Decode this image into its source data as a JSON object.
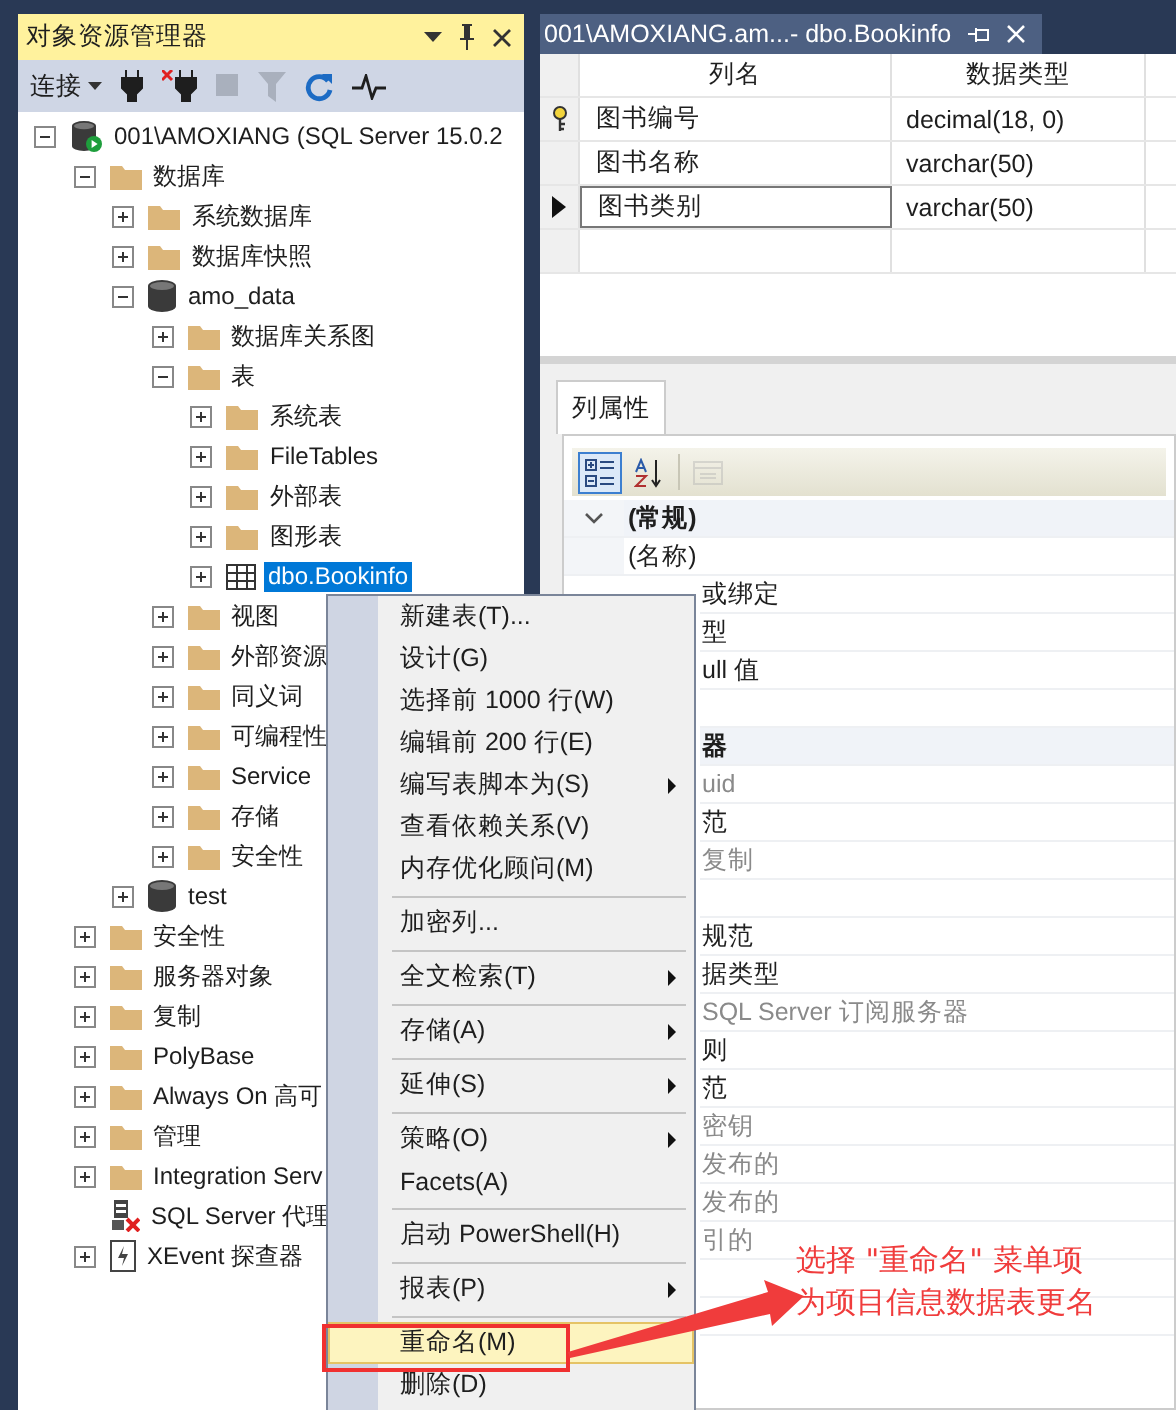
{
  "object_explorer": {
    "title": "对象资源管理器",
    "toolbar": {
      "connect_label": "连接",
      "buttons": [
        {
          "kind": "connect",
          "disabled": false
        },
        {
          "kind": "disconnect",
          "disabled": false
        },
        {
          "kind": "stop",
          "disabled": true
        },
        {
          "kind": "filter",
          "disabled": true
        },
        {
          "kind": "refresh",
          "disabled": false
        },
        {
          "kind": "activity",
          "disabled": false
        }
      ]
    },
    "tree": [
      {
        "label": "001\\AMOXIANG (SQL Server 15.0.2",
        "kind": "server",
        "expanded": true,
        "selected": false,
        "children": [
          {
            "label": "数据库",
            "kind": "folder",
            "expanded": true,
            "selected": false,
            "children": [
              {
                "label": "系统数据库",
                "kind": "folder",
                "expanded": false,
                "selected": false
              },
              {
                "label": "数据库快照",
                "kind": "folder",
                "expanded": false,
                "selected": false
              },
              {
                "label": "amo_data",
                "kind": "database",
                "expanded": true,
                "selected": false,
                "children": [
                  {
                    "label": "数据库关系图",
                    "kind": "folder",
                    "expanded": false,
                    "selected": false
                  },
                  {
                    "label": "表",
                    "kind": "folder",
                    "expanded": true,
                    "selected": false,
                    "children": [
                      {
                        "label": "系统表",
                        "kind": "folder",
                        "expanded": false,
                        "selected": false
                      },
                      {
                        "label": "FileTables",
                        "kind": "folder",
                        "expanded": false,
                        "selected": false
                      },
                      {
                        "label": "外部表",
                        "kind": "folder",
                        "expanded": false,
                        "selected": false
                      },
                      {
                        "label": "图形表",
                        "kind": "folder",
                        "expanded": false,
                        "selected": false
                      },
                      {
                        "label": "dbo.Bookinfo",
                        "kind": "table",
                        "expanded": false,
                        "selected": true
                      }
                    ]
                  },
                  {
                    "label": "视图",
                    "kind": "folder",
                    "expanded": false,
                    "selected": false
                  },
                  {
                    "label": "外部资源",
                    "kind": "folder",
                    "expanded": false,
                    "selected": false
                  },
                  {
                    "label": "同义词",
                    "kind": "folder",
                    "expanded": false,
                    "selected": false
                  },
                  {
                    "label": "可编程性",
                    "kind": "folder",
                    "expanded": false,
                    "selected": false
                  },
                  {
                    "label": "Service",
                    "kind": "folder",
                    "expanded": false,
                    "selected": false
                  },
                  {
                    "label": "存储",
                    "kind": "folder",
                    "expanded": false,
                    "selected": false
                  },
                  {
                    "label": "安全性",
                    "kind": "folder",
                    "expanded": false,
                    "selected": false
                  }
                ]
              },
              {
                "label": "test",
                "kind": "database",
                "expanded": false,
                "selected": false
              }
            ]
          },
          {
            "label": "安全性",
            "kind": "folder",
            "expanded": false,
            "selected": false
          },
          {
            "label": "服务器对象",
            "kind": "folder",
            "expanded": false,
            "selected": false
          },
          {
            "label": "复制",
            "kind": "folder",
            "expanded": false,
            "selected": false
          },
          {
            "label": "PolyBase",
            "kind": "folder",
            "expanded": false,
            "selected": false
          },
          {
            "label": "Always On 高可",
            "kind": "folder",
            "expanded": false,
            "selected": false
          },
          {
            "label": "管理",
            "kind": "folder",
            "expanded": false,
            "selected": false
          },
          {
            "label": "Integration Serv",
            "kind": "folder",
            "expanded": false,
            "selected": false
          },
          {
            "label": "SQL Server 代理",
            "kind": "agent",
            "selected": false
          },
          {
            "label": "XEvent 探查器",
            "kind": "xevent",
            "expanded": false,
            "selected": false
          }
        ]
      }
    ]
  },
  "document_tab": {
    "title": "001\\AMOXIANG.am...- dbo.Bookinfo"
  },
  "table_designer": {
    "columns": [
      "列名",
      "数据类型"
    ],
    "rows": [
      {
        "name": "图书编号",
        "type": "decimal(18, 0)",
        "primary_key": true,
        "selected": false
      },
      {
        "name": "图书名称",
        "type": "varchar(50)",
        "primary_key": false,
        "selected": false
      },
      {
        "name": "图书类别",
        "type": "varchar(50)",
        "primary_key": false,
        "selected": true
      }
    ]
  },
  "column_properties": {
    "tab": "列属性",
    "toolbar": [
      {
        "kind": "categorized",
        "selected": true,
        "disabled": false
      },
      {
        "kind": "alphabetical",
        "selected": false,
        "disabled": false
      },
      {
        "kind": "property_pages",
        "selected": false,
        "disabled": true
      }
    ],
    "rows": [
      {
        "kind": "category",
        "label": "(常规)",
        "expanded": true
      },
      {
        "kind": "property",
        "label": "(名称)",
        "dim": false
      }
    ],
    "rows_beside_menu": [
      {
        "kind": "property",
        "label": "或绑定",
        "dim": false
      },
      {
        "kind": "property",
        "label": "型",
        "dim": false
      },
      {
        "kind": "property",
        "label": "ull 值",
        "dim": false
      },
      {
        "kind": "property"
      },
      {
        "kind": "category",
        "label": "器"
      },
      {
        "kind": "property",
        "label": "uid",
        "dim": true
      },
      {
        "kind": "property",
        "label": "范",
        "dim": false
      },
      {
        "kind": "property",
        "label": "复制",
        "dim": true
      },
      {
        "kind": "property"
      },
      {
        "kind": "property",
        "label": "规范",
        "dim": false
      },
      {
        "kind": "property",
        "label": "据类型",
        "dim": false
      },
      {
        "kind": "property",
        "label": "SQL Server 订阅服务器",
        "dim": true
      },
      {
        "kind": "property",
        "label": "则",
        "dim": false
      },
      {
        "kind": "property",
        "label": "范",
        "dim": false
      },
      {
        "kind": "property",
        "label": "密钥",
        "dim": true
      },
      {
        "kind": "property",
        "label": "发布的",
        "dim": true
      },
      {
        "kind": "property",
        "label": "发布的",
        "dim": true
      },
      {
        "kind": "property",
        "label": "引的",
        "dim": true
      },
      {
        "kind": "property"
      },
      {
        "kind": "property"
      }
    ]
  },
  "context_menu": {
    "items": [
      {
        "kind": "item",
        "label": "新建表(T)...",
        "submenu": false,
        "selected": false
      },
      {
        "kind": "item",
        "label": "设计(G)",
        "submenu": false,
        "selected": false
      },
      {
        "kind": "item",
        "label": "选择前 1000 行(W)",
        "submenu": false,
        "selected": false
      },
      {
        "kind": "item",
        "label": "编辑前 200 行(E)",
        "submenu": false,
        "selected": false
      },
      {
        "kind": "item",
        "label": "编写表脚本为(S)",
        "submenu": true,
        "selected": false
      },
      {
        "kind": "item",
        "label": "查看依赖关系(V)",
        "submenu": false,
        "selected": false
      },
      {
        "kind": "item",
        "label": "内存优化顾问(M)",
        "submenu": false,
        "selected": false
      },
      {
        "kind": "separator"
      },
      {
        "kind": "item",
        "label": "加密列...",
        "submenu": false,
        "selected": false
      },
      {
        "kind": "separator"
      },
      {
        "kind": "item",
        "label": "全文检索(T)",
        "submenu": true,
        "selected": false
      },
      {
        "kind": "separator"
      },
      {
        "kind": "item",
        "label": "存储(A)",
        "submenu": true,
        "selected": false
      },
      {
        "kind": "separator"
      },
      {
        "kind": "item",
        "label": "延伸(S)",
        "submenu": true,
        "selected": false
      },
      {
        "kind": "separator"
      },
      {
        "kind": "item",
        "label": "策略(O)",
        "submenu": true,
        "selected": false
      },
      {
        "kind": "item",
        "label": "Facets(A)",
        "submenu": false,
        "selected": false
      },
      {
        "kind": "separator"
      },
      {
        "kind": "item",
        "label": "启动 PowerShell(H)",
        "submenu": false,
        "selected": false
      },
      {
        "kind": "separator"
      },
      {
        "kind": "item",
        "label": "报表(P)",
        "submenu": true,
        "selected": false
      },
      {
        "kind": "separator"
      },
      {
        "kind": "item",
        "label": "重命名(M)",
        "submenu": false,
        "selected": true
      },
      {
        "kind": "item",
        "label": "删除(D)",
        "submenu": false,
        "selected": false
      }
    ]
  },
  "annotation": {
    "lines": [
      "选择 \"重命名\" 菜单项",
      "为项目信息数据表更名"
    ]
  }
}
